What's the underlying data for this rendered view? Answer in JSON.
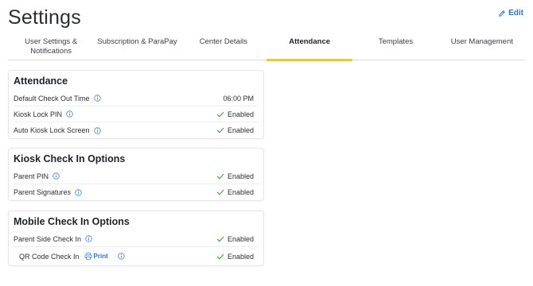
{
  "page": {
    "title": "Settings",
    "edit_label": "Edit"
  },
  "tabs": [
    {
      "label": "User Settings &\nNotifications",
      "active": false
    },
    {
      "label": "Subscription & ParaPay",
      "active": false
    },
    {
      "label": "Center Details",
      "active": false
    },
    {
      "label": "Attendance",
      "active": true
    },
    {
      "label": "Templates",
      "active": false
    },
    {
      "label": "User Management",
      "active": false
    }
  ],
  "cards": {
    "attendance": {
      "title": "Attendance",
      "rows": [
        {
          "label": "Default Check Out Time",
          "value": "06:00 PM"
        },
        {
          "label": "Kiosk Lock PIN",
          "value": "Enabled"
        },
        {
          "label": "Auto Kiosk Lock Screen",
          "value": "Enabled"
        }
      ]
    },
    "kiosk": {
      "title": "Kiosk Check In Options",
      "rows": [
        {
          "label": "Parent PIN",
          "value": "Enabled"
        },
        {
          "label": "Parent Signatures",
          "value": "Enabled"
        }
      ]
    },
    "mobile": {
      "title": "Mobile Check In Options",
      "rows": [
        {
          "label": "Parent Side Check In",
          "value": "Enabled"
        },
        {
          "label": "QR Code Check In",
          "print_label": "Print",
          "value": "Enabled"
        }
      ]
    }
  },
  "colors": {
    "accent": "#f4c430",
    "link": "#2c73c9",
    "check": "#3aa655"
  },
  "icons": {
    "edit": "pencil-icon",
    "info": "info-icon",
    "check": "check-icon",
    "print": "printer-icon"
  }
}
